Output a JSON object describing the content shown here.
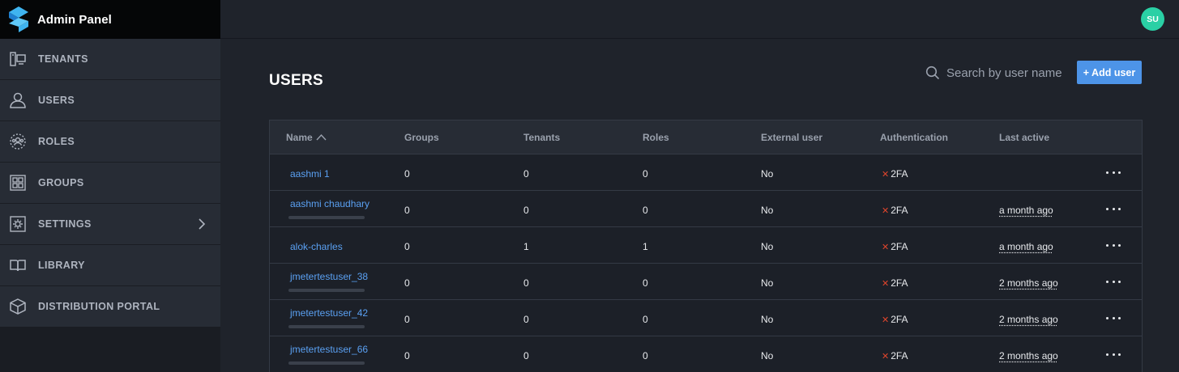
{
  "app": {
    "title": "Admin Panel"
  },
  "user_avatar": "SU",
  "sidebar": {
    "items": [
      {
        "label": "TENANTS",
        "icon": "tenants-icon"
      },
      {
        "label": "USERS",
        "icon": "user-icon"
      },
      {
        "label": "ROLES",
        "icon": "roles-icon"
      },
      {
        "label": "GROUPS",
        "icon": "groups-icon"
      },
      {
        "label": "SETTINGS",
        "icon": "gear-icon",
        "has_chevron": true
      },
      {
        "label": "LIBRARY",
        "icon": "book-icon"
      },
      {
        "label": "DISTRIBUTION PORTAL",
        "icon": "cube-icon"
      }
    ]
  },
  "main": {
    "title": "USERS",
    "search": {
      "placeholder": "Search by user name"
    },
    "add_button": "+ Add user"
  },
  "table": {
    "columns": [
      "Name",
      "Groups",
      "Tenants",
      "Roles",
      "External user",
      "Authentication",
      "Last active"
    ],
    "rows": [
      {
        "name": "aashmi 1",
        "groups": "0",
        "tenants": "0",
        "roles": "0",
        "external": "No",
        "auth": "2FA",
        "last_active": ""
      },
      {
        "name": "aashmi chaudhary",
        "groups": "0",
        "tenants": "0",
        "roles": "0",
        "external": "No",
        "auth": "2FA",
        "last_active": "a month ago"
      },
      {
        "name": "alok-charles",
        "groups": "0",
        "tenants": "1",
        "roles": "1",
        "external": "No",
        "auth": "2FA",
        "last_active": "a month ago"
      },
      {
        "name": "jmetertestuser_38",
        "groups": "0",
        "tenants": "0",
        "roles": "0",
        "external": "No",
        "auth": "2FA",
        "last_active": "2 months ago"
      },
      {
        "name": "jmetertestuser_42",
        "groups": "0",
        "tenants": "0",
        "roles": "0",
        "external": "No",
        "auth": "2FA",
        "last_active": "2 months ago"
      },
      {
        "name": "jmetertestuser_66",
        "groups": "0",
        "tenants": "0",
        "roles": "0",
        "external": "No",
        "auth": "2FA",
        "last_active": "2 months ago"
      }
    ]
  },
  "colors": {
    "accent": "#4d94e8",
    "link": "#5aa0f2",
    "avatar": "#2ad0a5",
    "auth_fail": "#e0452c"
  }
}
